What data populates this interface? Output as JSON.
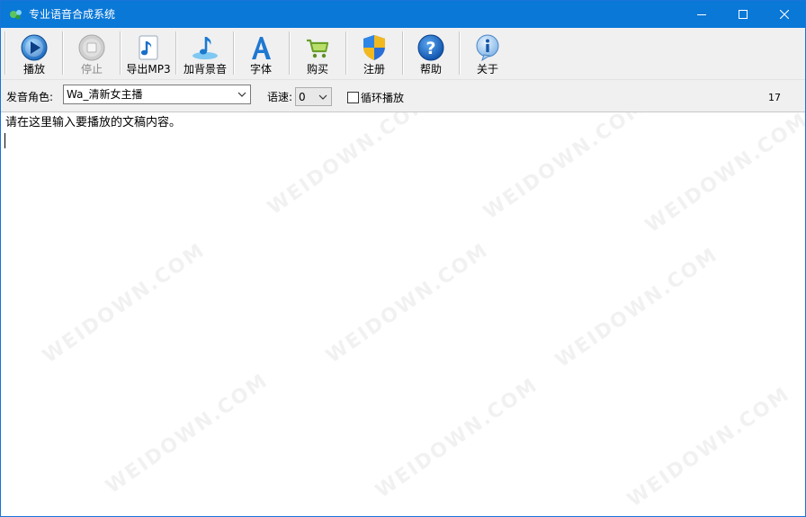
{
  "window": {
    "title": "专业语音合成系统",
    "controls": {
      "minimize": "minimize",
      "maximize": "maximize",
      "close": "close"
    }
  },
  "toolbar": {
    "items": [
      {
        "label": "播放",
        "icon": "play-icon",
        "enabled": true
      },
      {
        "label": "停止",
        "icon": "stop-icon",
        "enabled": false
      },
      {
        "label": "导出MP3",
        "icon": "music-note-icon",
        "enabled": true
      },
      {
        "label": "加背景音",
        "icon": "music-note-disc-icon",
        "enabled": true
      },
      {
        "label": "字体",
        "icon": "font-a-icon",
        "enabled": true
      },
      {
        "label": "购买",
        "icon": "shopping-cart-icon",
        "enabled": true
      },
      {
        "label": "注册",
        "icon": "shield-icon",
        "enabled": true
      },
      {
        "label": "帮助",
        "icon": "help-icon",
        "enabled": true
      },
      {
        "label": "关于",
        "icon": "info-icon",
        "enabled": true
      }
    ]
  },
  "options": {
    "voice_label": "发音角色:",
    "voice_value": "Wa_清新女主播",
    "speed_label": "语速:",
    "speed_value": "0",
    "loop_label": "循环播放",
    "loop_checked": false,
    "char_count": "17"
  },
  "editor": {
    "content": "请在这里输入要播放的文稿内容。"
  },
  "watermark": "WEIDOWN.COM",
  "colors": {
    "titlebar": "#0a78d7",
    "toolbar": "#f0f0f0"
  }
}
